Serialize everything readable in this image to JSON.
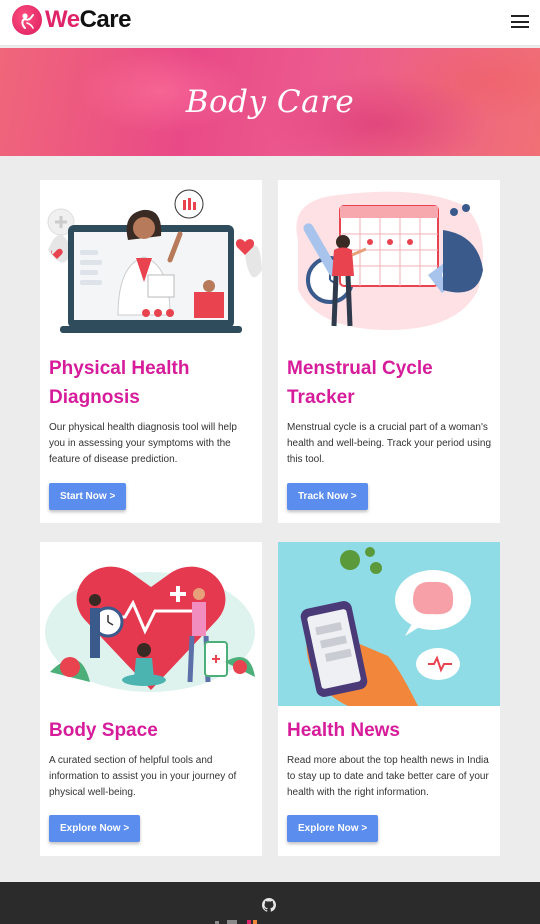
{
  "navbar": {
    "logo_we": "We",
    "logo_care": "Care"
  },
  "hero": {
    "title": "Body Care"
  },
  "cards": [
    {
      "title": "Physical Health Diagnosis",
      "description": "Our physical health diagnosis tool will help you in assessing your symptoms with the feature of disease prediction.",
      "button": "Start Now >"
    },
    {
      "title": "Menstrual Cycle Tracker",
      "description": "Menstrual cycle is a crucial part of a woman's health and well-being. Track your period using this tool.",
      "button": "Track Now >"
    },
    {
      "title": "Body Space",
      "description": "A curated section of helpful tools and information to assist you in your journey of physical well-being.",
      "button": "Explore Now >"
    },
    {
      "title": "Health News",
      "description": "Read more about the top health news in India to stay up to date and take better care of your health with the right information.",
      "button": "Explore Now >"
    }
  ],
  "colors": {
    "accent": "#d61c9a",
    "button": "#5b8def",
    "brand": "#e0246a",
    "footer": "#2b2b2b"
  }
}
